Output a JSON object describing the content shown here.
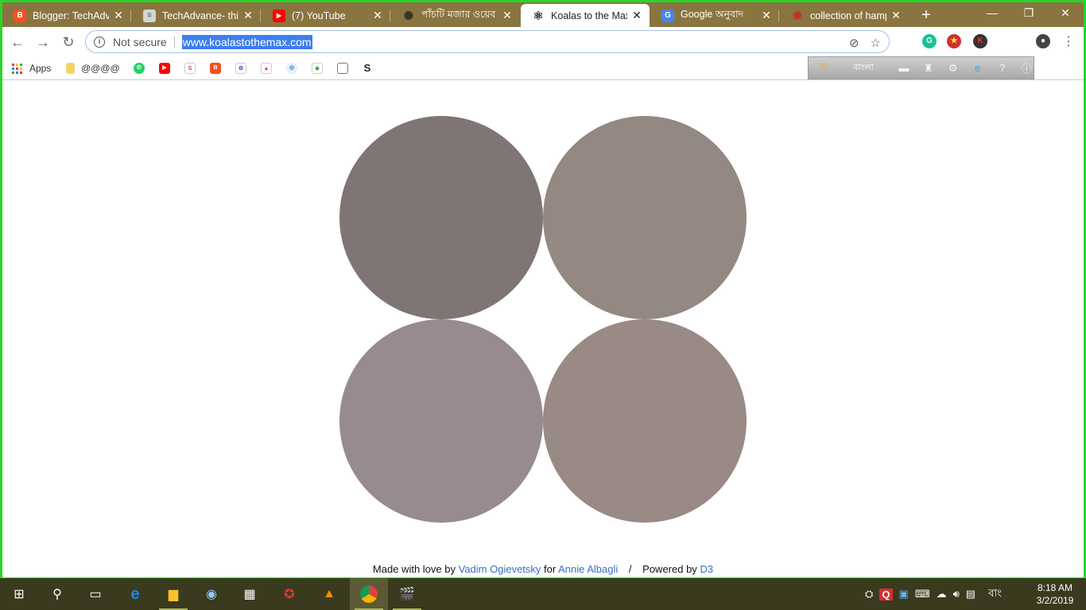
{
  "browser": {
    "tabs": [
      {
        "title": "Blogger: TechAdvance",
        "icon": "blogger-icon",
        "color": "#f4511e",
        "glyph": "B"
      },
      {
        "title": "TechAdvance- this",
        "icon": "document-icon",
        "color": "#d0d8d0",
        "glyph": "≡"
      },
      {
        "title": "(7) YouTube",
        "icon": "youtube-icon",
        "color": "#ff0000",
        "glyph": "▶"
      },
      {
        "title": "পাঁচটি মজার ওয়েব",
        "icon": "web-icon",
        "color": "#555555",
        "glyph": "✺"
      },
      {
        "title": "Koalas to the Max",
        "icon": "react-icon",
        "color": "#ffffff",
        "glyph": "⚛"
      },
      {
        "title": "Google অনুবাদ",
        "icon": "google-translate-icon",
        "color": "#4285f4",
        "glyph": "G"
      },
      {
        "title": "collection of hamp",
        "icon": "rose-icon",
        "color": "#c62828",
        "glyph": "❀"
      }
    ],
    "active_tab": 4,
    "new_tab_label": "+",
    "security_label": "Not secure",
    "url": "www.koalastothemax.com",
    "bookmarks": [
      {
        "label": "Apps",
        "icon": "apps-icon"
      },
      {
        "label": "@@@@",
        "icon": "folder-icon"
      }
    ]
  },
  "bangla_toolbar": {
    "language_label": "বাংলা"
  },
  "page": {
    "circles": [
      {
        "color": "#7f7575"
      },
      {
        "color": "#938882"
      },
      {
        "color": "#978b8d"
      },
      {
        "color": "#998a85"
      }
    ],
    "footer": {
      "made_with": "Made with love by",
      "author": "Vadim Ogievetsky",
      "for_label": "for",
      "recipient": "Annie Albagli",
      "separator": "/",
      "powered_by": "Powered by",
      "powered_link": "D3"
    }
  },
  "taskbar": {
    "language": "বাং",
    "time": "8:18 AM",
    "date": "3/2/2019"
  },
  "colors": {
    "tab_strip": "#8a7540",
    "taskbar": "#3a3a1e",
    "accent_border": "#2bd42b"
  }
}
